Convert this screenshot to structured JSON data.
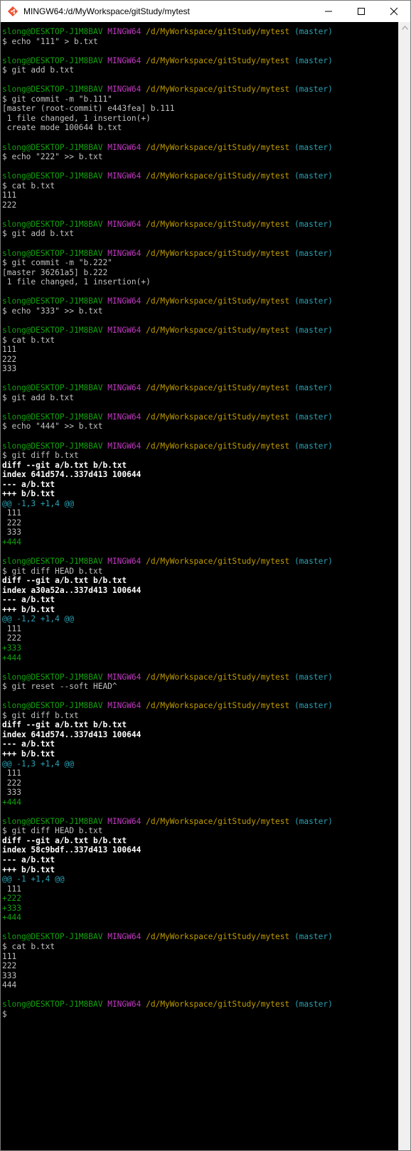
{
  "window": {
    "title": "MINGW64:/d/MyWorkspace/gitStudy/mytest",
    "controls": [
      "minimize",
      "maximize",
      "close"
    ]
  },
  "prompt": {
    "user": "slong@DESKTOP-J1M8BAV",
    "system": "MINGW64",
    "path": "/d/MyWorkspace/gitStudy/mytest",
    "branch": "(master)"
  },
  "lines": [
    {
      "kind": "prompt"
    },
    {
      "kind": "cmd",
      "text": "$ echo \"111\" > b.txt"
    },
    {
      "kind": "blank",
      "text": ""
    },
    {
      "kind": "prompt"
    },
    {
      "kind": "cmd",
      "text": "$ git add b.txt"
    },
    {
      "kind": "blank",
      "text": ""
    },
    {
      "kind": "prompt"
    },
    {
      "kind": "cmd",
      "text": "$ git commit -m \"b.111\""
    },
    {
      "kind": "out",
      "text": "[master (root-commit) e443fea] b.111"
    },
    {
      "kind": "out",
      "text": " 1 file changed, 1 insertion(+)"
    },
    {
      "kind": "out",
      "text": " create mode 100644 b.txt"
    },
    {
      "kind": "blank",
      "text": ""
    },
    {
      "kind": "prompt"
    },
    {
      "kind": "cmd",
      "text": "$ echo \"222\" >> b.txt"
    },
    {
      "kind": "blank",
      "text": ""
    },
    {
      "kind": "prompt"
    },
    {
      "kind": "cmd",
      "text": "$ cat b.txt"
    },
    {
      "kind": "out",
      "text": "111"
    },
    {
      "kind": "out",
      "text": "222"
    },
    {
      "kind": "blank",
      "text": ""
    },
    {
      "kind": "prompt"
    },
    {
      "kind": "cmd",
      "text": "$ git add b.txt"
    },
    {
      "kind": "blank",
      "text": ""
    },
    {
      "kind": "prompt"
    },
    {
      "kind": "cmd",
      "text": "$ git commit -m \"b.222\""
    },
    {
      "kind": "out",
      "text": "[master 36261a5] b.222"
    },
    {
      "kind": "out",
      "text": " 1 file changed, 1 insertion(+)"
    },
    {
      "kind": "blank",
      "text": ""
    },
    {
      "kind": "prompt"
    },
    {
      "kind": "cmd",
      "text": "$ echo \"333\" >> b.txt"
    },
    {
      "kind": "blank",
      "text": ""
    },
    {
      "kind": "prompt"
    },
    {
      "kind": "cmd",
      "text": "$ cat b.txt"
    },
    {
      "kind": "out",
      "text": "111"
    },
    {
      "kind": "out",
      "text": "222"
    },
    {
      "kind": "out",
      "text": "333"
    },
    {
      "kind": "blank",
      "text": ""
    },
    {
      "kind": "prompt"
    },
    {
      "kind": "cmd",
      "text": "$ git add b.txt"
    },
    {
      "kind": "blank",
      "text": ""
    },
    {
      "kind": "prompt"
    },
    {
      "kind": "cmd",
      "text": "$ echo \"444\" >> b.txt"
    },
    {
      "kind": "blank",
      "text": ""
    },
    {
      "kind": "prompt"
    },
    {
      "kind": "cmd",
      "text": "$ git diff b.txt"
    },
    {
      "kind": "bold",
      "text": "diff --git a/b.txt b/b.txt"
    },
    {
      "kind": "bold",
      "text": "index 641d574..337d413 100644"
    },
    {
      "kind": "bold",
      "text": "--- a/b.txt"
    },
    {
      "kind": "bold",
      "text": "+++ b/b.txt"
    },
    {
      "kind": "hunk",
      "text": "@@ -1,3 +1,4 @@"
    },
    {
      "kind": "out",
      "text": " 111"
    },
    {
      "kind": "out",
      "text": " 222"
    },
    {
      "kind": "out",
      "text": " 333"
    },
    {
      "kind": "add",
      "text": "+444"
    },
    {
      "kind": "blank",
      "text": ""
    },
    {
      "kind": "prompt"
    },
    {
      "kind": "cmd",
      "text": "$ git diff HEAD b.txt"
    },
    {
      "kind": "bold",
      "text": "diff --git a/b.txt b/b.txt"
    },
    {
      "kind": "bold",
      "text": "index a30a52a..337d413 100644"
    },
    {
      "kind": "bold",
      "text": "--- a/b.txt"
    },
    {
      "kind": "bold",
      "text": "+++ b/b.txt"
    },
    {
      "kind": "hunk",
      "text": "@@ -1,2 +1,4 @@"
    },
    {
      "kind": "out",
      "text": " 111"
    },
    {
      "kind": "out",
      "text": " 222"
    },
    {
      "kind": "add",
      "text": "+333"
    },
    {
      "kind": "add",
      "text": "+444"
    },
    {
      "kind": "blank",
      "text": ""
    },
    {
      "kind": "prompt"
    },
    {
      "kind": "cmd",
      "text": "$ git reset --soft HEAD^"
    },
    {
      "kind": "blank",
      "text": ""
    },
    {
      "kind": "prompt"
    },
    {
      "kind": "cmd",
      "text": "$ git diff b.txt"
    },
    {
      "kind": "bold",
      "text": "diff --git a/b.txt b/b.txt"
    },
    {
      "kind": "bold",
      "text": "index 641d574..337d413 100644"
    },
    {
      "kind": "bold",
      "text": "--- a/b.txt"
    },
    {
      "kind": "bold",
      "text": "+++ b/b.txt"
    },
    {
      "kind": "hunk",
      "text": "@@ -1,3 +1,4 @@"
    },
    {
      "kind": "out",
      "text": " 111"
    },
    {
      "kind": "out",
      "text": " 222"
    },
    {
      "kind": "out",
      "text": " 333"
    },
    {
      "kind": "add",
      "text": "+444"
    },
    {
      "kind": "blank",
      "text": ""
    },
    {
      "kind": "prompt"
    },
    {
      "kind": "cmd",
      "text": "$ git diff HEAD b.txt"
    },
    {
      "kind": "bold",
      "text": "diff --git a/b.txt b/b.txt"
    },
    {
      "kind": "bold",
      "text": "index 58c9bdf..337d413 100644"
    },
    {
      "kind": "bold",
      "text": "--- a/b.txt"
    },
    {
      "kind": "bold",
      "text": "+++ b/b.txt"
    },
    {
      "kind": "hunk",
      "text": "@@ -1 +1,4 @@"
    },
    {
      "kind": "out",
      "text": " 111"
    },
    {
      "kind": "add",
      "text": "+222"
    },
    {
      "kind": "add",
      "text": "+333"
    },
    {
      "kind": "add",
      "text": "+444"
    },
    {
      "kind": "blank",
      "text": ""
    },
    {
      "kind": "prompt"
    },
    {
      "kind": "cmd",
      "text": "$ cat b.txt"
    },
    {
      "kind": "out",
      "text": "111"
    },
    {
      "kind": "out",
      "text": "222"
    },
    {
      "kind": "out",
      "text": "333"
    },
    {
      "kind": "out",
      "text": "444"
    },
    {
      "kind": "blank",
      "text": ""
    },
    {
      "kind": "prompt"
    },
    {
      "kind": "cmd",
      "text": "$ "
    }
  ],
  "colors": {
    "background": "#000000",
    "user": "#13a10e",
    "system": "#c239c1",
    "path": "#c19c00",
    "branch": "#2aa1b3",
    "added": "#13a10e",
    "hunk": "#2aa1b3"
  },
  "icons": {
    "app": "git-icon",
    "minimize": "minimize-icon",
    "maximize": "maximize-icon",
    "close": "close-icon"
  }
}
